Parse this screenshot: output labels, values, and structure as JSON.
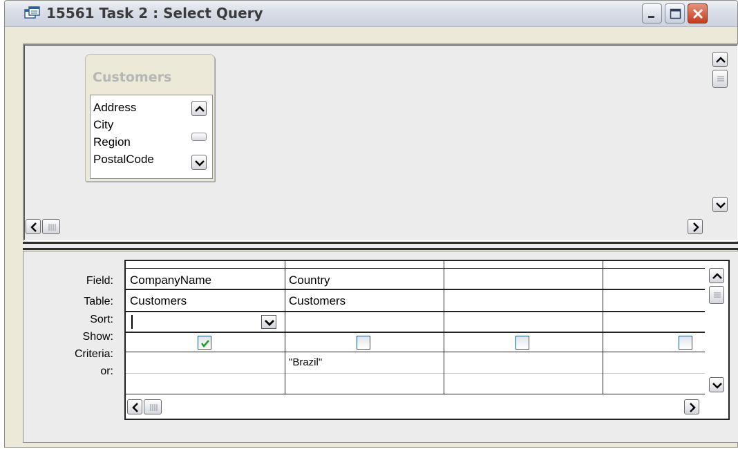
{
  "window": {
    "title": "15561 Task 2 : Select Query",
    "controls": {
      "minimize_icon": "minimize-icon",
      "maximize_icon": "maximize-icon",
      "close_icon": "close-icon"
    },
    "close_color": "#d9411e"
  },
  "table_widget": {
    "caption": "Customers",
    "fields": [
      "Address",
      "City",
      "Region",
      "PostalCode"
    ]
  },
  "grid": {
    "row_labels": {
      "field": "Field:",
      "table": "Table:",
      "sort": "Sort:",
      "show": "Show:",
      "criteria": "Criteria:",
      "or": "or:"
    },
    "columns": [
      {
        "field": "CompanyName",
        "table": "Customers",
        "sort": "",
        "show": true,
        "criteria": "",
        "or": ""
      },
      {
        "field": "Country",
        "table": "Customers",
        "sort": "",
        "show": false,
        "criteria": "\"Brazil\"",
        "or": ""
      },
      {
        "field": "",
        "table": "",
        "sort": "",
        "show": false,
        "criteria": "",
        "or": ""
      },
      {
        "field": "",
        "table": "",
        "sort": "",
        "show": false,
        "criteria": "",
        "or": ""
      }
    ]
  },
  "colors": {
    "pane_bg": "#ececec",
    "frame_bg": "#ece9d8",
    "check_green": "#21a121",
    "grid_line": "#222222"
  }
}
